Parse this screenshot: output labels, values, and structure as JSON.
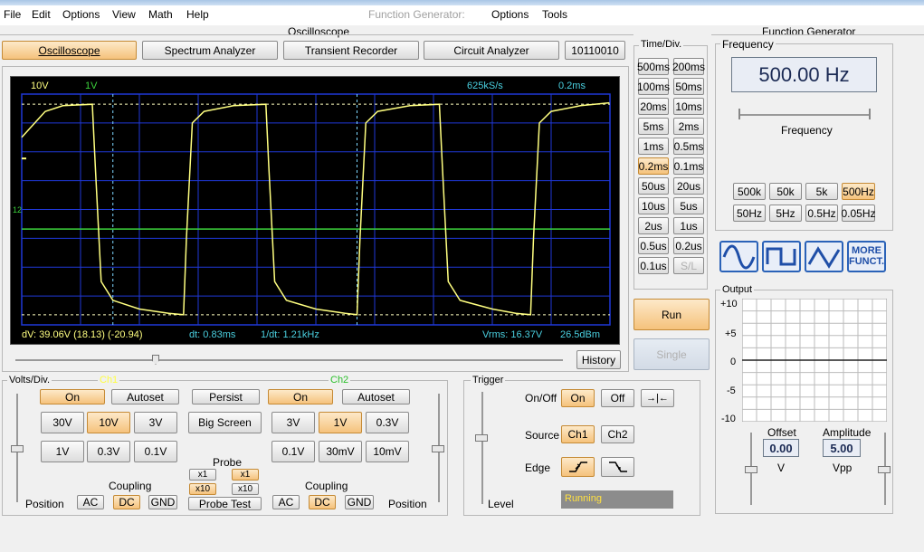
{
  "app": {
    "menu": [
      "File",
      "Edit",
      "Options",
      "View",
      "Math",
      "Help"
    ],
    "fg_title": "Function Generator:",
    "fg_menu": [
      "Options",
      "Tools"
    ]
  },
  "scope_panel": {
    "title": "Oscilloscope",
    "tabs": [
      "Oscilloscope",
      "Spectrum Analyzer",
      "Transient Recorder",
      "Circuit Analyzer",
      "10110010"
    ],
    "active_tab": "Oscilloscope"
  },
  "display": {
    "ch1_scale": "10V",
    "ch2_scale": "1V",
    "sample_rate": "625kS/s",
    "timebase": "0.2ms",
    "ch2_marker": "12",
    "dv": "dV: 39.06V  (18.13) (-20.94)",
    "dt": "dt: 0.83ms",
    "inv_dt": "1/dt: 1.21kHz",
    "vrms": "Vrms: 16.37V",
    "dbm": "26.5dBm",
    "colors": {
      "ch1": "#ffff80",
      "ch2": "#3cd23c",
      "grid": "#1f38d8",
      "cursor_text": "#ffff80",
      "info_text": "#4ad0e0"
    },
    "waveform_ch1": [
      [
        0,
        5
      ],
      [
        0.4,
        6.8
      ],
      [
        0.7,
        7.2
      ],
      [
        1.2,
        7.3
      ],
      [
        1.25,
        3
      ],
      [
        1.35,
        -5
      ],
      [
        1.55,
        -6.3
      ],
      [
        2.0,
        -6.9
      ],
      [
        2.5,
        -7.2
      ],
      [
        2.75,
        -7.3
      ],
      [
        2.8,
        -2
      ],
      [
        2.9,
        6
      ],
      [
        3.1,
        6.8
      ],
      [
        3.6,
        7.2
      ],
      [
        4.15,
        7.3
      ],
      [
        4.2,
        3
      ],
      [
        4.3,
        -5
      ],
      [
        4.5,
        -6.3
      ],
      [
        5.0,
        -6.9
      ],
      [
        5.5,
        -7.2
      ],
      [
        5.7,
        -7.3
      ],
      [
        5.75,
        -2
      ],
      [
        5.85,
        6
      ],
      [
        6.05,
        6.8
      ],
      [
        6.6,
        7.2
      ],
      [
        7.1,
        7.3
      ],
      [
        7.15,
        3
      ],
      [
        7.25,
        -5
      ],
      [
        7.45,
        -6.3
      ],
      [
        8.0,
        -6.9
      ],
      [
        8.4,
        -7.2
      ],
      [
        8.65,
        -7.3
      ],
      [
        8.7,
        -2
      ],
      [
        8.8,
        6
      ],
      [
        9.0,
        6.8
      ],
      [
        9.5,
        7.2
      ],
      [
        9.99,
        7.4
      ]
    ]
  },
  "history_label": "History",
  "timediv": {
    "title": "Time/Div.",
    "buttons": [
      "500ms",
      "200ms",
      "100ms",
      "50ms",
      "20ms",
      "10ms",
      "5ms",
      "2ms",
      "1ms",
      "0.5ms",
      "0.2ms",
      "0.1ms",
      "50us",
      "20us",
      "10us",
      "5us",
      "2us",
      "1us",
      "0.5us",
      "0.2us",
      "0.1us",
      "S/L"
    ],
    "selected": "0.2ms"
  },
  "run_label": "Run",
  "single_label": "Single",
  "volts": {
    "title": "Volts/Div.",
    "ch1_label": "Ch1",
    "ch2_label": "Ch2",
    "on": "On",
    "autoset": "Autoset",
    "persist": "Persist",
    "big_screen": "Big Screen",
    "ch1_ranges": [
      "30V",
      "10V",
      "3V",
      "1V",
      "0.3V",
      "0.1V"
    ],
    "ch1_selected": "10V",
    "ch2_ranges": [
      "3V",
      "1V",
      "0.3V",
      "0.1V",
      "30mV",
      "10mV"
    ],
    "ch2_selected": "1V",
    "probe_title": "Probe",
    "probe": [
      "x1",
      "x10"
    ],
    "probe_test": "Probe Test",
    "coupling_title": "Coupling",
    "coupling": [
      "AC",
      "DC",
      "GND"
    ],
    "coupling_selected": "DC",
    "position": "Position"
  },
  "trigger": {
    "title": "Trigger",
    "onoff_label": "On/Off",
    "on": "On",
    "off": "Off",
    "center_icon": "→|←",
    "source_label": "Source",
    "sources": [
      "Ch1",
      "Ch2"
    ],
    "edge_label": "Edge",
    "level_label": "Level",
    "status": "Running"
  },
  "fg": {
    "title": "Function Generator",
    "frequency_group": "Frequency",
    "frequency": "500.00 Hz",
    "slider_label": "Frequency",
    "ranges": [
      "500k",
      "50k",
      "5k",
      "500Hz",
      "50Hz",
      "5Hz",
      "0.5Hz",
      "0.05Hz"
    ],
    "range_selected": "500Hz",
    "more": [
      "MORE",
      "FUNCT."
    ],
    "output_title": "Output",
    "y_ticks": [
      "+10",
      "+5",
      "0",
      "-5",
      "-10"
    ],
    "offset_label": "Offset",
    "offset_value": "0.00",
    "offset_unit": "V",
    "amplitude_label": "Amplitude",
    "amplitude_value": "5.00",
    "amplitude_unit": "Vpp"
  }
}
